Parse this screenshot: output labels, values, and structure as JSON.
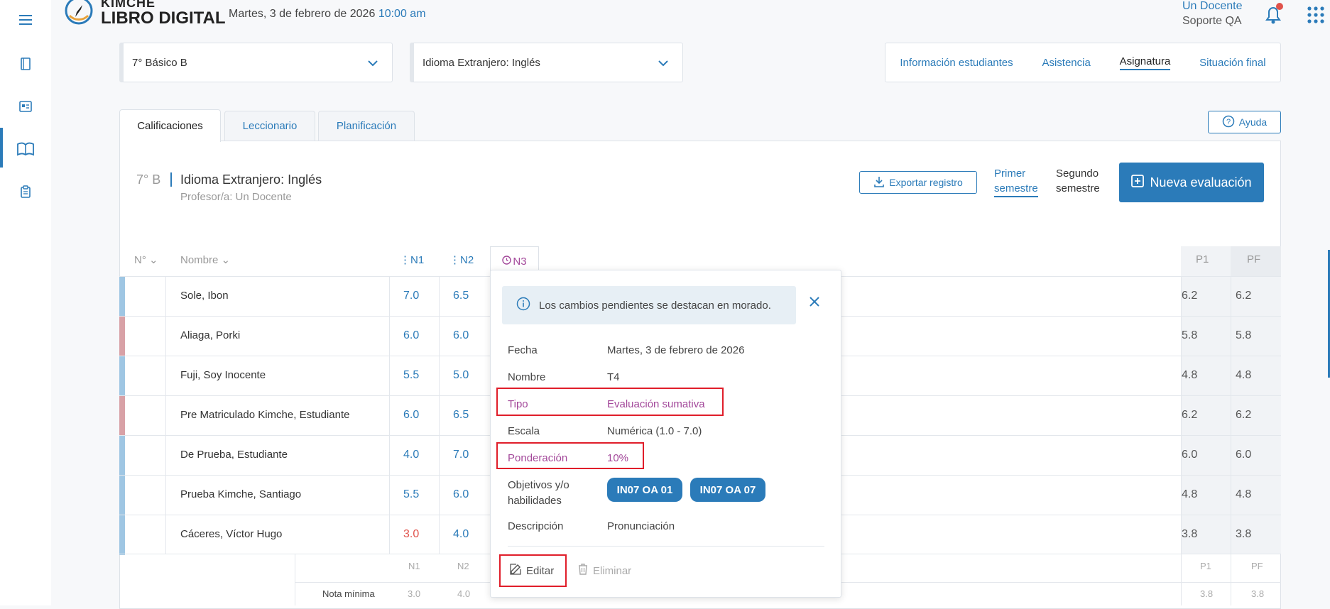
{
  "header": {
    "logo_top": "KIMCHE",
    "logo_bottom": "LIBRO DIGITAL",
    "date": "Martes, 3 de febrero de 2026",
    "time": "10:00 am",
    "user_name": "Un Docente",
    "user_role": "Soporte QA"
  },
  "selects": {
    "course": "7° Básico B",
    "subject": "Idioma Extranjero: Inglés"
  },
  "topnav": [
    "Información estudiantes",
    "Asistencia",
    "Asignatura",
    "Situación final"
  ],
  "tabs": [
    "Calificaciones",
    "Leccionario",
    "Planificación"
  ],
  "help_label": "Ayuda",
  "subject_header": {
    "course_short": "7° B",
    "subject": "Idioma Extranjero: Inglés",
    "teacher": "Profesor/a: Un Docente"
  },
  "export_label": "Exportar registro",
  "semester1": [
    "Primer",
    "semestre"
  ],
  "semester2": [
    "Segundo",
    "semestre"
  ],
  "new_eval_label": "Nueva evaluación",
  "columns": {
    "num": "N°",
    "name": "Nombre",
    "n1": "N1",
    "n2": "N2",
    "n3": "N3",
    "p1": "P1",
    "pf": "PF"
  },
  "students": [
    {
      "name": "Sole, Ibon",
      "n1": "7.0",
      "n2": "6.5",
      "p1": "6.2",
      "pf": "6.2",
      "bar": "#9fc6e3"
    },
    {
      "name": "Aliaga, Porki",
      "n1": "6.0",
      "n2": "6.0",
      "p1": "5.8",
      "pf": "5.8",
      "bar": "#d8a1a6"
    },
    {
      "name": "Fuji, Soy Inocente",
      "n1": "5.5",
      "n2": "5.0",
      "p1": "4.8",
      "pf": "4.8",
      "bar": "#9fc6e3"
    },
    {
      "name": "Pre Matriculado Kimche, Estudiante",
      "n1": "6.0",
      "n2": "6.5",
      "p1": "6.2",
      "pf": "6.2",
      "bar": "#d8a1a6"
    },
    {
      "name": "De Prueba, Estudiante",
      "n1": "4.0",
      "n2": "7.0",
      "p1": "6.0",
      "pf": "6.0",
      "bar": "#9fc6e3"
    },
    {
      "name": "Prueba Kimche, Santiago",
      "n1": "5.5",
      "n2": "6.0",
      "p1": "4.8",
      "pf": "4.8",
      "bar": "#9fc6e3"
    },
    {
      "name": "Cáceres, Víctor Hugo",
      "n1": "3.0",
      "n2": "4.0",
      "p1": "3.8",
      "pf": "3.8",
      "bar": "#9fc6e3"
    }
  ],
  "footer": {
    "n1": "N1",
    "n2": "N2",
    "p1": "P1",
    "pf": "PF",
    "min_label": "Nota mínima",
    "min_n1": "3.0",
    "min_n2": "4.0",
    "min_p1": "3.8",
    "min_pf": "3.8"
  },
  "popover": {
    "info": "Los cambios pendientes se destacan en morado.",
    "fecha_label": "Fecha",
    "fecha": "Martes, 3 de febrero de 2026",
    "nombre_label": "Nombre",
    "nombre": "T4",
    "tipo_label": "Tipo",
    "tipo": "Evaluación sumativa",
    "escala_label": "Escala",
    "escala": "Numérica (1.0 - 7.0)",
    "ponderacion_label": "Ponderación",
    "ponderacion": "10%",
    "objetivos_label_1": "Objetivos y/o",
    "objetivos_label_2": "habilidades",
    "objetivos": [
      "IN07 OA 01",
      "IN07 OA 07"
    ],
    "descripcion_label": "Descripción",
    "descripcion": "Pronunciación",
    "edit_label": "Editar",
    "delete_label": "Eliminar"
  },
  "colors": {
    "accent": "#2b7bb9",
    "pending": "#a3489a",
    "highlight": "#e01e2a",
    "fail": "#e0524b"
  }
}
